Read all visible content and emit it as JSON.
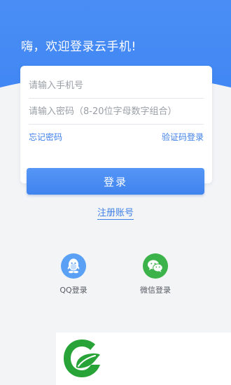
{
  "header": {
    "welcome": "嗨，欢迎登录云手机!"
  },
  "form": {
    "phone_placeholder": "请输入手机号",
    "password_placeholder": "请输入密码（8-20位字母数字组合）",
    "forgot_password": "忘记密码",
    "code_login": "验证码登录",
    "login_button": "登录"
  },
  "register": {
    "label": "注册账号"
  },
  "social": {
    "qq_label": "QQ登录",
    "wechat_label": "微信登录"
  },
  "colors": {
    "primary": "#3f83ef",
    "link": "#3f7fe8",
    "qq": "#5aa0f5",
    "wechat": "#3cb34a",
    "logo_green": "#27a338"
  },
  "icons": {
    "qq": "qq-penguin-icon",
    "wechat": "wechat-bubbles-icon",
    "logo": "green-leaf-g-logo"
  }
}
